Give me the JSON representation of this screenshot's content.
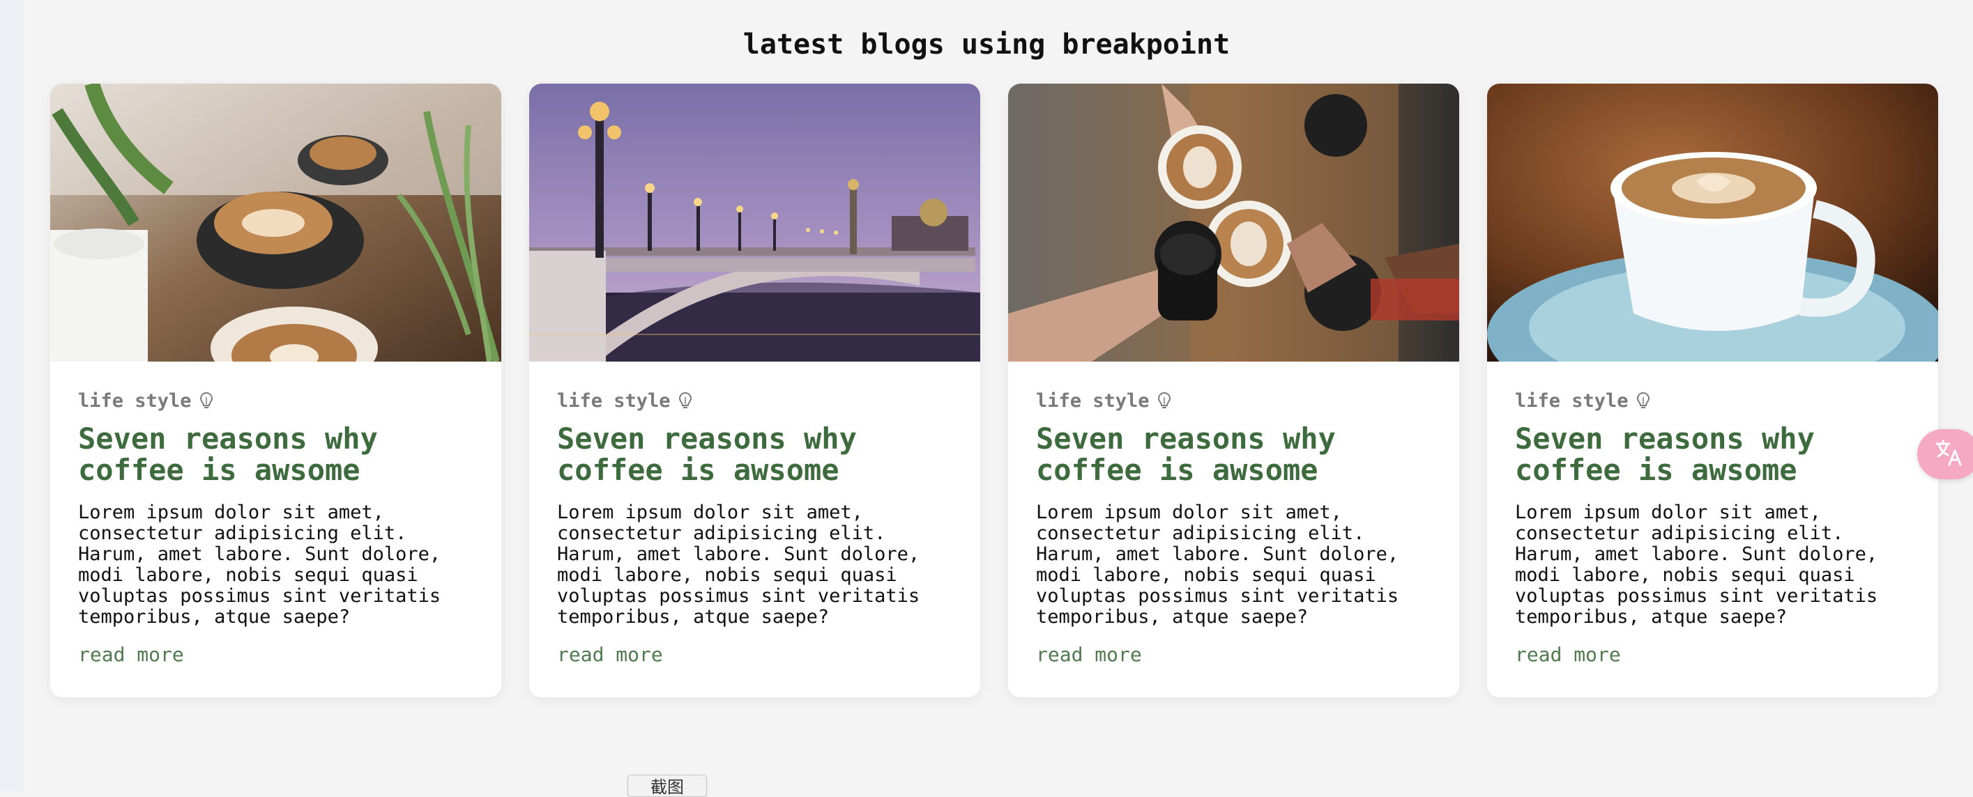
{
  "page": {
    "title": "latest blogs using breakpoint"
  },
  "cards": [
    {
      "image": "coffee-latte-plants-photo",
      "category": "life style",
      "category_icon": "lightbulb-icon",
      "title": "Seven reasons why coffee is awsome",
      "excerpt": "Lorem ipsum dolor sit amet, consectetur adipisicing elit. Harum, amet labore. Sunt dolore, modi labore, nobis sequi quasi voluptas possimus sint veritatis temporibus, atque saepe?",
      "link": "read more"
    },
    {
      "image": "paris-bridge-dusk-photo",
      "category": "life style",
      "category_icon": "lightbulb-icon",
      "title": "Seven reasons why coffee is awsome",
      "excerpt": "Lorem ipsum dolor sit amet, consectetur adipisicing elit. Harum, amet labore. Sunt dolore, modi labore, nobis sequi quasi voluptas possimus sint veritatis temporibus, atque saepe?",
      "link": "read more"
    },
    {
      "image": "coffee-cheers-hands-photo",
      "category": "life style",
      "category_icon": "lightbulb-icon",
      "title": "Seven reasons why coffee is awsome",
      "excerpt": "Lorem ipsum dolor sit amet, consectetur adipisicing elit. Harum, amet labore. Sunt dolore, modi labore, nobis sequi quasi voluptas possimus sint veritatis temporibus, atque saepe?",
      "link": "read more"
    },
    {
      "image": "latte-cup-saucer-photo",
      "category": "life style",
      "category_icon": "lightbulb-icon",
      "title": "Seven reasons why coffee is awsome",
      "excerpt": "Lorem ipsum dolor sit amet, consectetur adipisicing elit. Harum, amet labore. Sunt dolore, modi labore, nobis sequi quasi voluptas possimus sint veritatis temporibus, atque saepe?",
      "link": "read more"
    }
  ],
  "overlay": {
    "translate_icon": "translate-icon",
    "screenshot_label": "截图"
  },
  "colors": {
    "background": "#f4f4f4",
    "card": "#ffffff",
    "title_green": "#3d6b3e",
    "link_green": "#4f7a4f",
    "category_gray": "#7a7a7a",
    "fab_pink": "#f6a9c2"
  }
}
